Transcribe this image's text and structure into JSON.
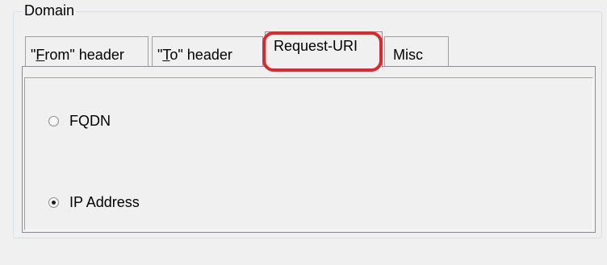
{
  "group": {
    "title": "Domain"
  },
  "tabs": [
    {
      "prefix": "\"",
      "mnemonic": "F",
      "rest": "rom\" header",
      "active": false
    },
    {
      "prefix": "\"",
      "mnemonic": "T",
      "rest": "o\" header",
      "active": false
    },
    {
      "label": "Request-URI",
      "active": true
    },
    {
      "label": "Misc",
      "active": false
    }
  ],
  "options": {
    "fqdn_label": "FQDN",
    "fqdn_checked": false,
    "ip_label": "IP Address",
    "ip_checked": true
  },
  "colors": {
    "highlight": "#e0262f",
    "background": "#f0f0f0"
  }
}
